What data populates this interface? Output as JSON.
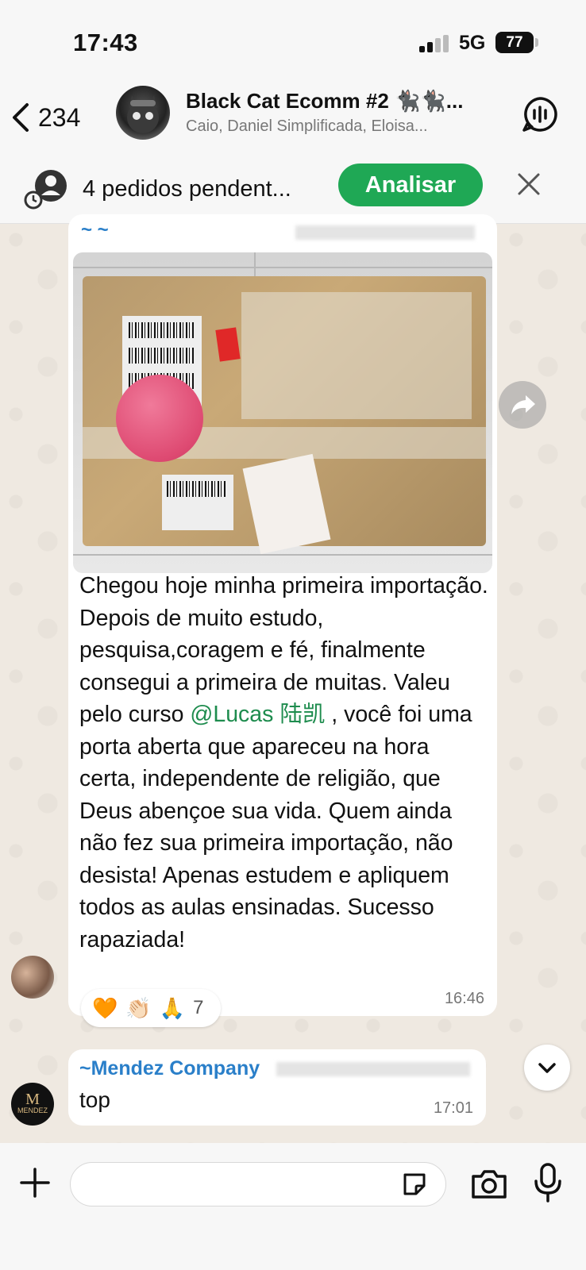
{
  "status_bar": {
    "time": "17:43",
    "network": "5G",
    "battery": "77"
  },
  "header": {
    "back_count": "234",
    "group_name": "Black Cat Ecomm #2 🐈‍⬛🐈‍⬛...",
    "members": "Caio, Daniel Simplificada, Eloisa..."
  },
  "pending": {
    "text": "4 pedidos pendent...",
    "button_label": "Analisar"
  },
  "messages": [
    {
      "sender": "~ ~",
      "text_before_mention": "Chegou hoje minha primeira importação. Depois de muito estudo, pesquisa,coragem e fé, finalmente consegui a primeira de muitas. Valeu pelo curso ",
      "mention": "@Lucas 陆凯",
      "text_after_mention": " , você foi uma porta aberta que apareceu na hora certa, independente de religião, que Deus abençoe sua vida. Quem ainda não fez sua primeira importação, não desista! Apenas estudem e apliquem todos as aulas ensinadas. Sucesso rapaziada!",
      "time": "16:46",
      "reactions": [
        "🧡",
        "👏🏻",
        "🙏"
      ],
      "reaction_count": "7"
    },
    {
      "sender": "~Mendez Company",
      "text": "top",
      "time": "17:01",
      "avatar_text": "MENDEZ"
    }
  ],
  "input": {
    "placeholder": ""
  },
  "colors": {
    "accent_green": "#1fa855",
    "mention_green": "#1e8c4e",
    "sender_blue": "#2a7fc9"
  }
}
